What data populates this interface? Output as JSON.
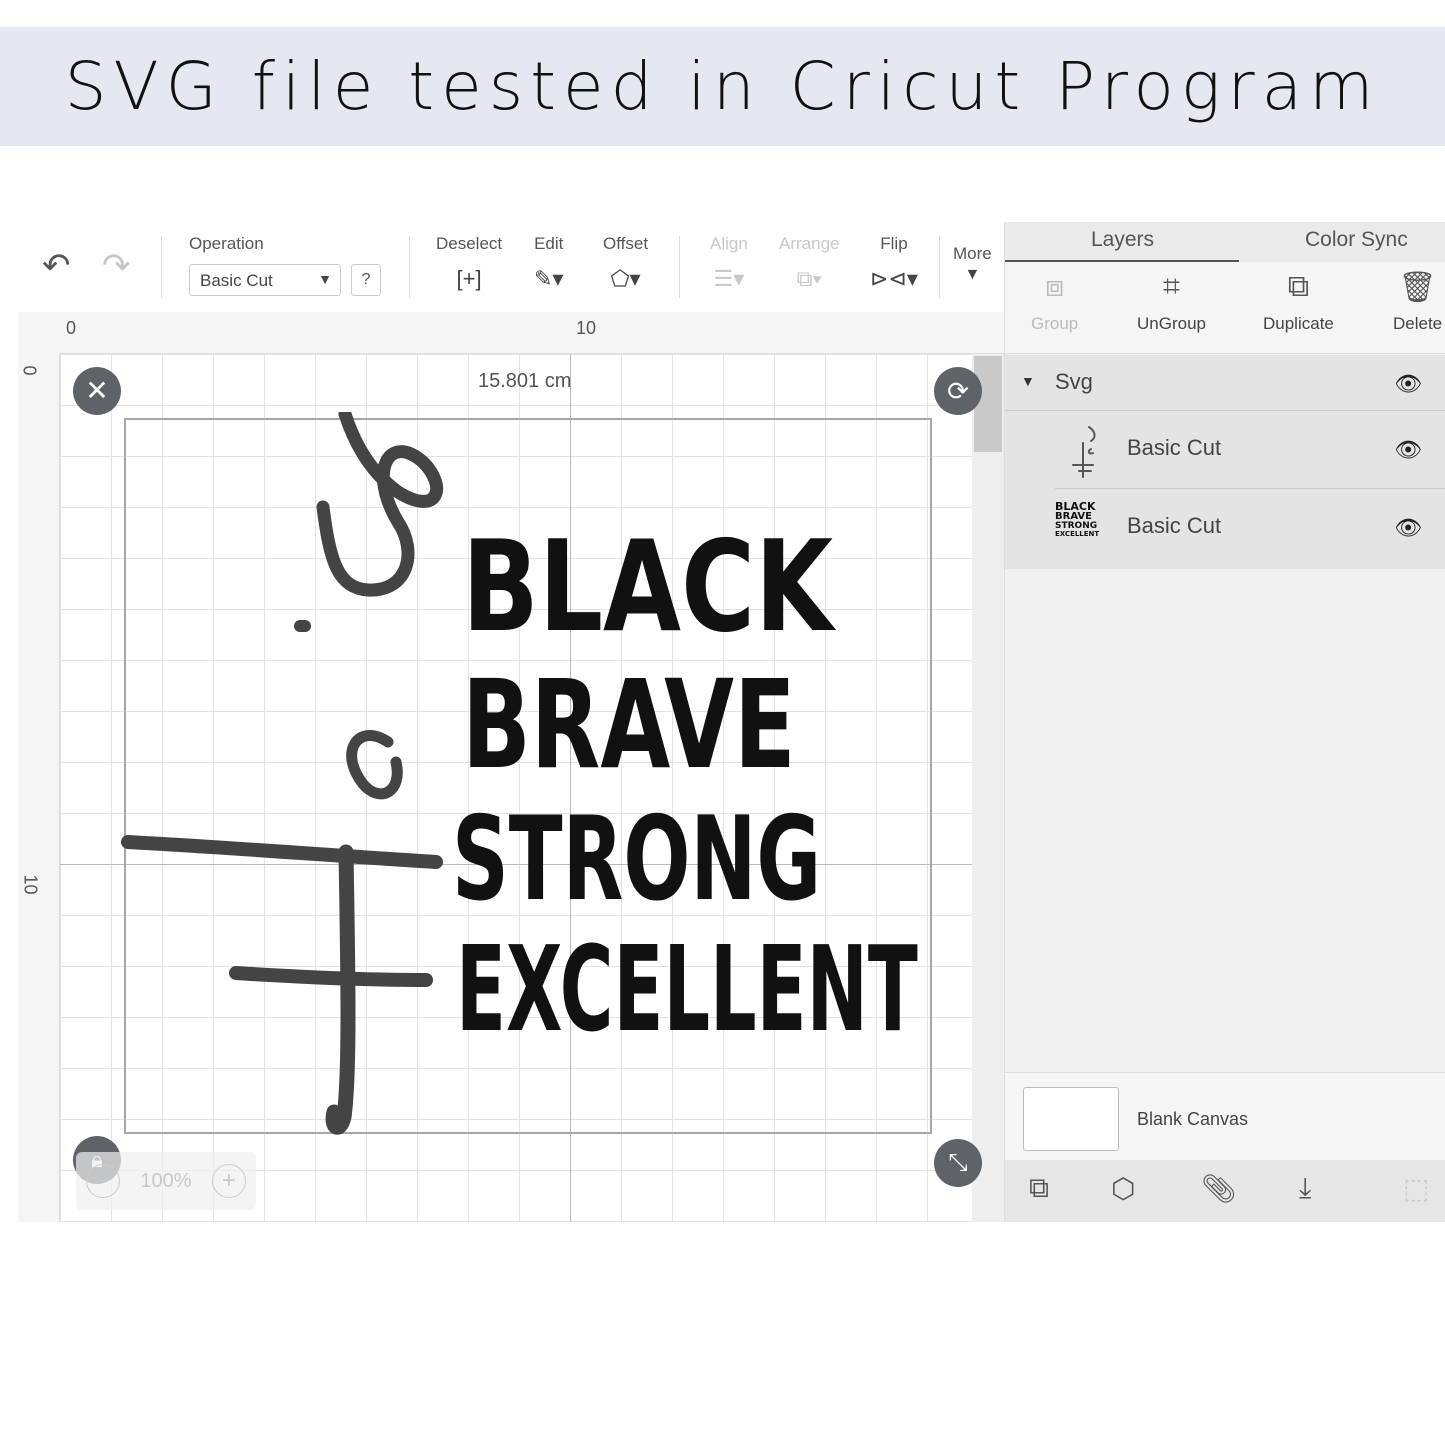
{
  "banner": {
    "title": "SVG file tested in Cricut Program"
  },
  "toolbar": {
    "operation_label": "Operation",
    "operation_value": "Basic Cut",
    "help": "?",
    "deselect": "Deselect",
    "edit": "Edit",
    "offset": "Offset",
    "align": "Align",
    "arrange": "Arrange",
    "flip": "Flip",
    "more": "More"
  },
  "rulers": {
    "top": [
      "0",
      "10"
    ],
    "left": [
      "0",
      "10"
    ]
  },
  "canvas": {
    "dimension": "15.801 cm",
    "zoom": "100%",
    "design_words": [
      "BLACK",
      "BRAVE",
      "STRONG",
      "EXCELLENT"
    ]
  },
  "panel": {
    "tabs": [
      "Layers",
      "Color Sync"
    ],
    "actions": [
      "Group",
      "UnGroup",
      "Duplicate",
      "Delete"
    ],
    "group_name": "Svg",
    "layers": [
      {
        "name": "Basic Cut"
      },
      {
        "name": "Basic Cut",
        "thumb_lines": [
          "BLACK",
          "BRAVE",
          "STRONG",
          "EXCELLENT"
        ]
      }
    ],
    "canvas_label": "Blank Canvas"
  }
}
